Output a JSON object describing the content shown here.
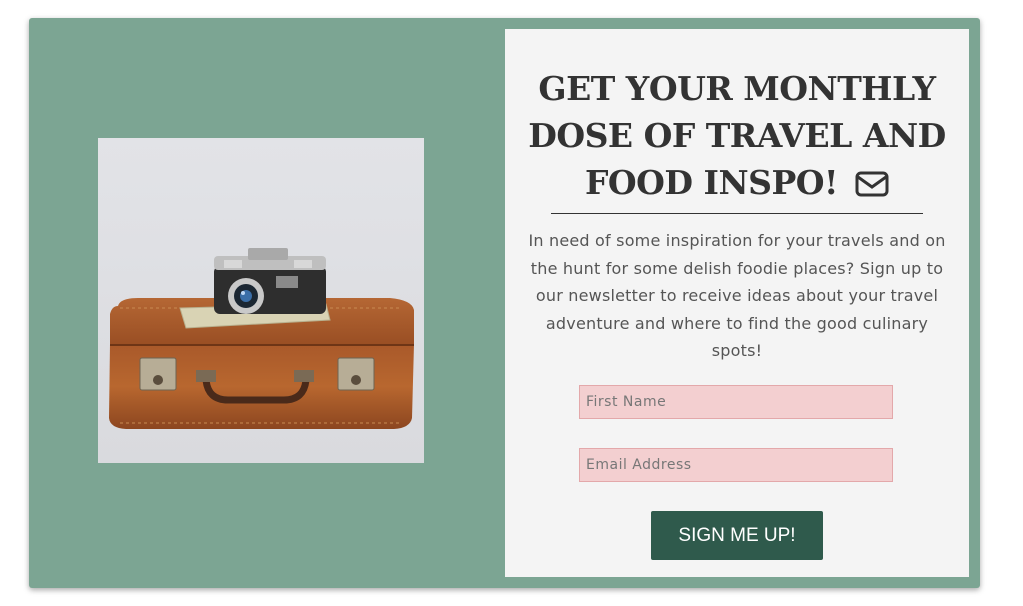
{
  "newsletter": {
    "headline": "GET YOUR MONTHLY DOSE OF TRAVEL AND FOOD INSPO!",
    "headline_icon": "envelope-icon",
    "description": "In need of some inspiration for your travels and on the hunt for some delish foodie places? Sign up to our newsletter to receive ideas about your travel adventure and where to find the good culinary spots!",
    "first_name_placeholder": "First Name",
    "email_placeholder": "Email Address",
    "submit_label": "SIGN ME UP!",
    "image": "vintage-camera-on-suitcase-photo"
  },
  "colors": {
    "card_background": "#7ca593",
    "panel_background": "#f4f4f4",
    "input_background": "#f3cfd0",
    "button_background": "#2f5a4c"
  }
}
